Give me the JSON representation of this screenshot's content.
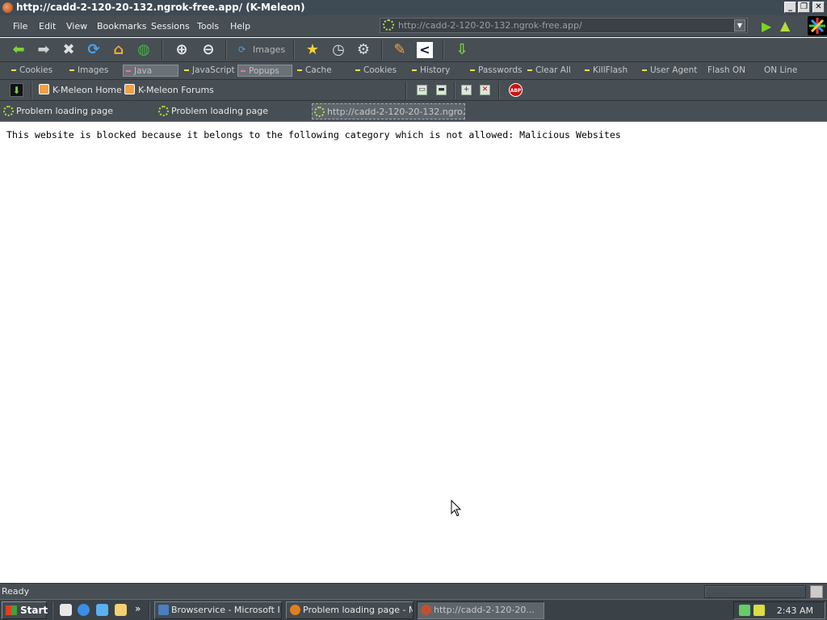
{
  "window": {
    "title": "http://cadd-2-120-20-132.ngrok-free.app/ (K-Meleon)",
    "minimize_glyph": "_",
    "restore_glyph": "❐",
    "close_glyph": "✕"
  },
  "menu": {
    "items": [
      "File",
      "Edit",
      "View",
      "Bookmarks",
      "Sessions",
      "Tools",
      "Help"
    ]
  },
  "address": {
    "url": "http://cadd-2-120-20-132.ngrok-free.app/"
  },
  "navbar": {
    "images_label": "Images"
  },
  "prefbar": {
    "items": [
      "Cookies",
      "Images",
      "Java",
      "JavaScript",
      "Popups",
      "Cache",
      "Cookies",
      "History",
      "Passwords",
      "Clear All",
      "KillFlash",
      "User Agent",
      "Flash ON",
      "ON Line"
    ]
  },
  "bookmarks": {
    "items": [
      "K-Meleon Home",
      "K-Meleon Forums"
    ],
    "abp_label": "ABP"
  },
  "tabs": [
    {
      "label": "Problem loading page"
    },
    {
      "label": "Problem loading page"
    },
    {
      "label": "http://cadd-2-120-20-132.ngro..."
    }
  ],
  "page": {
    "message": "This website is blocked because it belongs to the following category which is not allowed: Malicious Websites"
  },
  "status": {
    "text": "Ready"
  },
  "taskbar": {
    "start_label": "Start",
    "chevron": "»",
    "buttons": [
      {
        "label": "Browservice - Microsoft I..."
      },
      {
        "label": "Problem loading page - M..."
      },
      {
        "label": "http://cadd-2-120-20..."
      }
    ],
    "clock": "2:43 AM"
  },
  "colors": {
    "chrome": "#474e54",
    "accent_green": "#b6dd3c",
    "title_bar": "#3e4a54"
  }
}
